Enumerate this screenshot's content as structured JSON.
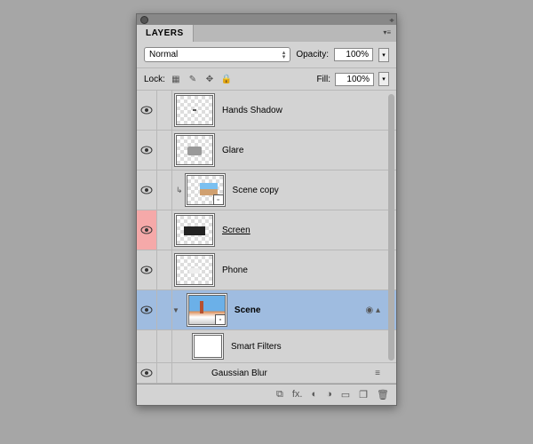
{
  "panel_title": "LAYERS",
  "blend_mode": "Normal",
  "opacity_label": "Opacity:",
  "opacity_value": "100%",
  "lock_label": "Lock:",
  "fill_label": "Fill:",
  "fill_value": "100%",
  "layers": [
    {
      "name": "Hands Shadow"
    },
    {
      "name": "Glare"
    },
    {
      "name": "Scene copy"
    },
    {
      "name": "Screen"
    },
    {
      "name": "Phone"
    },
    {
      "name": "Scene"
    }
  ],
  "smart_filters_label": "Smart Filters",
  "filter_name": "Gaussian Blur"
}
